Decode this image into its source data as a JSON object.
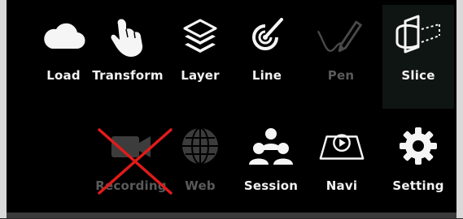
{
  "toolbar": {
    "row1": [
      {
        "id": "load",
        "label": "Load",
        "icon": "cloud-icon",
        "enabled": true
      },
      {
        "id": "transform",
        "label": "Transform",
        "icon": "hand-icon",
        "enabled": true
      },
      {
        "id": "layer",
        "label": "Layer",
        "icon": "layers-icon",
        "enabled": true
      },
      {
        "id": "line",
        "label": "Line",
        "icon": "line-target-icon",
        "enabled": true
      },
      {
        "id": "pen",
        "label": "Pen",
        "icon": "pen-icon",
        "enabled": false
      },
      {
        "id": "slice",
        "label": "Slice",
        "icon": "slice-icon",
        "enabled": true,
        "selected": true
      }
    ],
    "row2": [
      {
        "id": "recording",
        "label": "Recording",
        "icon": "video-camera-icon",
        "enabled": false,
        "crossed_out": true
      },
      {
        "id": "web",
        "label": "Web",
        "icon": "globe-icon",
        "enabled": false
      },
      {
        "id": "session",
        "label": "Session",
        "icon": "people-icon",
        "enabled": true
      },
      {
        "id": "navi",
        "label": "Navi",
        "icon": "navigation-icon",
        "enabled": true
      },
      {
        "id": "setting",
        "label": "Setting",
        "icon": "gear-icon",
        "enabled": true
      }
    ]
  },
  "colors": {
    "background": "#000000",
    "label_enabled": "#f2f2f2",
    "label_disabled": "#5a5a5a",
    "icon_disabled": "#4a4a4a",
    "selected_bg": "#0f1513",
    "cross": "#e01b1b"
  }
}
